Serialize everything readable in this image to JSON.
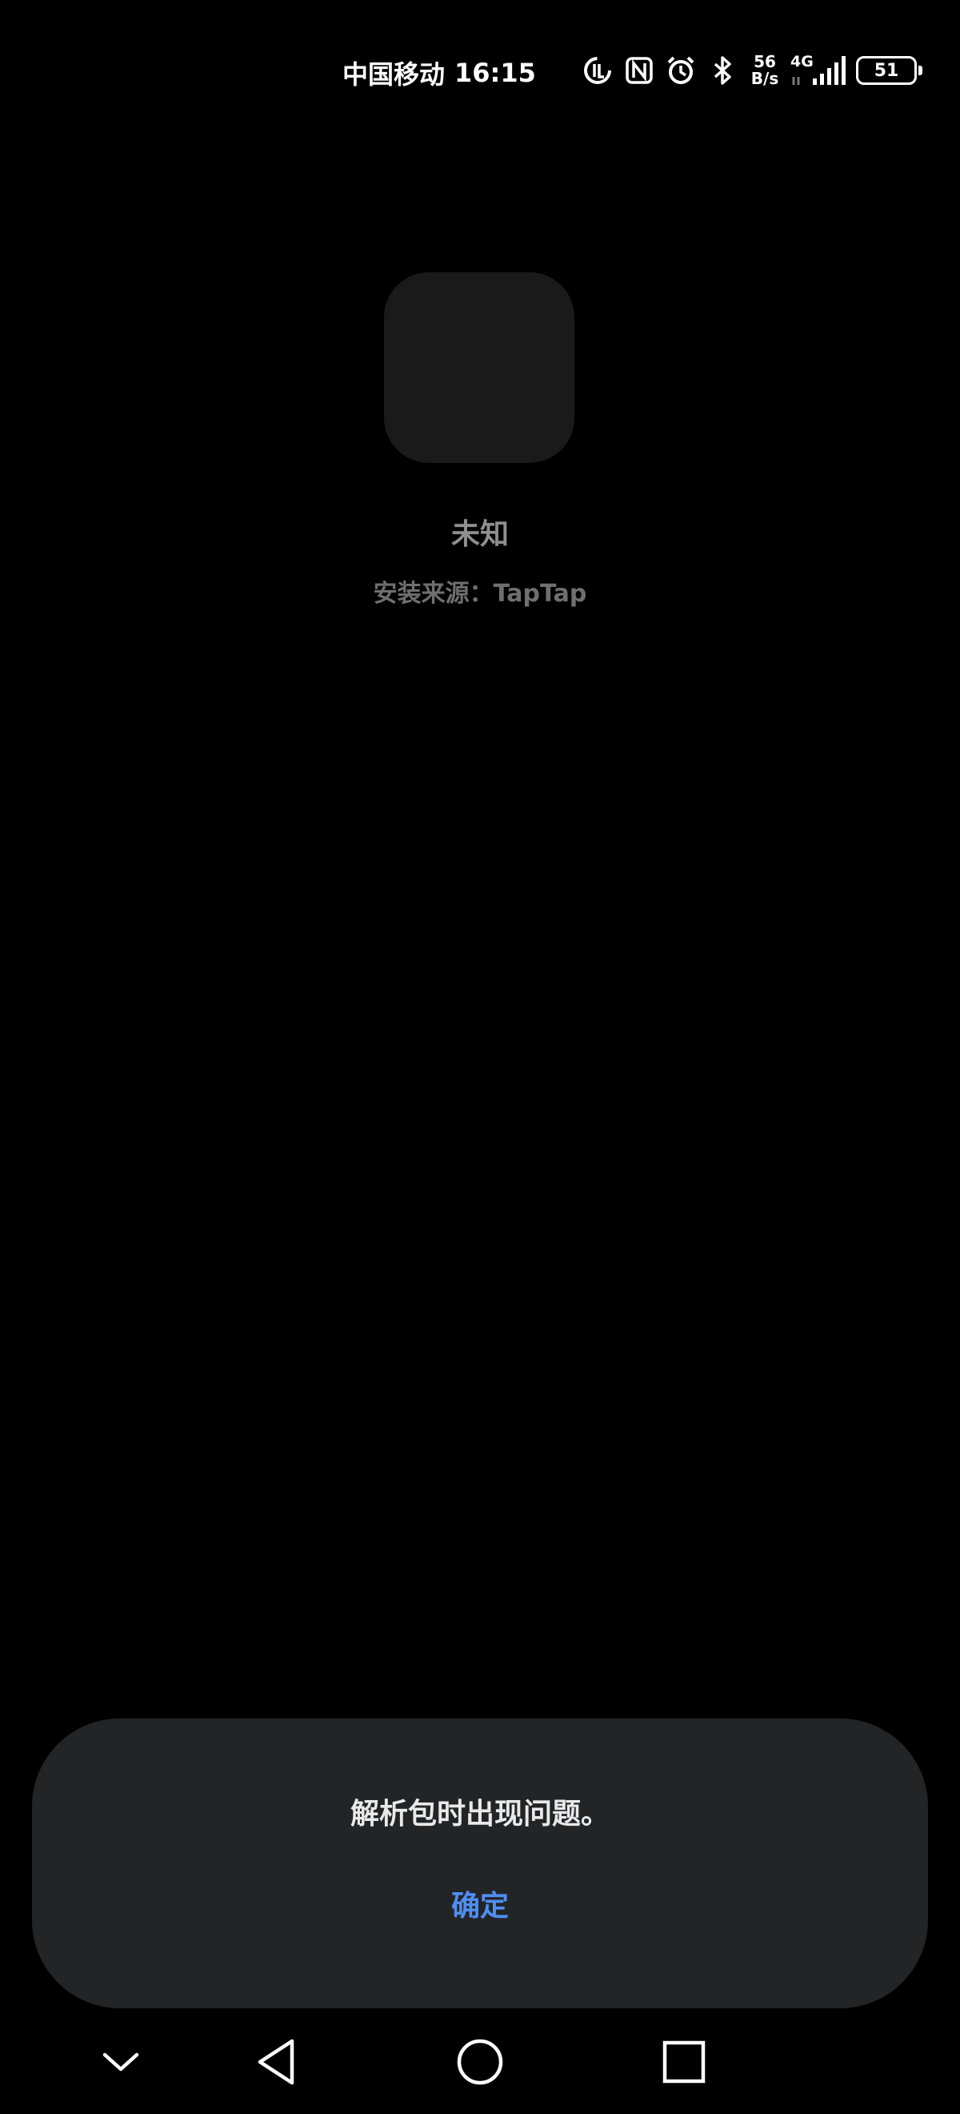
{
  "status_bar": {
    "carrier": "中国移动",
    "time": "16:15",
    "net_speed_value": "56",
    "net_speed_unit": "B/s",
    "network_type": "4G",
    "battery_level": "51",
    "icons": [
      "data-saver-icon",
      "nfc-icon",
      "alarm-icon",
      "bluetooth-icon",
      "signal-icon",
      "battery-icon"
    ]
  },
  "app": {
    "name": "未知",
    "install_source": "安装来源：TapTap"
  },
  "dialog": {
    "message": "解析包时出现问题。",
    "confirm_label": "确定",
    "accent_color": "#4f8ef4"
  },
  "nav_bar": {
    "icons": [
      "collapse-icon",
      "back-icon",
      "home-icon",
      "recents-icon"
    ]
  }
}
